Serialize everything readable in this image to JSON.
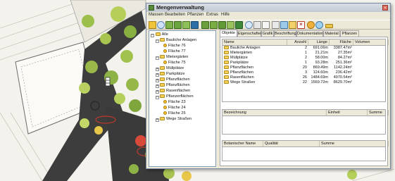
{
  "window": {
    "title": "Mengenverwaltung"
  },
  "menu": [
    "Massen",
    "Bearbeiten",
    "Pflanzen",
    "Extras",
    "Hilfe"
  ],
  "tree": {
    "root": "Alle",
    "items": [
      {
        "label": "Bauliche Anlagen",
        "type": "folder",
        "level": 1,
        "expanded": true
      },
      {
        "label": "Fläche 76",
        "type": "leaf",
        "level": 2
      },
      {
        "label": "Fläche 77",
        "type": "leaf",
        "level": 2
      },
      {
        "label": "Mietergärten",
        "type": "folder",
        "level": 1,
        "expanded": true
      },
      {
        "label": "Fläche 75",
        "type": "leaf",
        "level": 2
      },
      {
        "label": "Müllplätze",
        "type": "folder",
        "level": 1,
        "expanded": false
      },
      {
        "label": "Parkplätze",
        "type": "folder",
        "level": 1,
        "expanded": false
      },
      {
        "label": "Pflanzflächen",
        "type": "folder",
        "level": 1,
        "expanded": false
      },
      {
        "label": "Pflanzflächen",
        "type": "folder",
        "level": 1,
        "expanded": false
      },
      {
        "label": "Rasenflächen",
        "type": "folder",
        "level": 1,
        "expanded": false
      },
      {
        "label": "Pflanzerflächen",
        "type": "folder",
        "level": 1,
        "expanded": true
      },
      {
        "label": "Fläche 23",
        "type": "leaf",
        "level": 2
      },
      {
        "label": "Fläche 24",
        "type": "leaf",
        "level": 2
      },
      {
        "label": "Fläche 25",
        "type": "leaf",
        "level": 2
      },
      {
        "label": "Wege Straßen",
        "type": "folder",
        "level": 1,
        "expanded": false
      }
    ]
  },
  "tabs": [
    "Objekte",
    "Eigenschaften",
    "Grafik",
    "Beschriftung",
    "Dokumentation",
    "Material",
    "Pflanzen"
  ],
  "active_tab": "Objekte",
  "objects_table": {
    "headers": [
      "Name",
      "Anzahl",
      "Länge",
      "Fläche",
      "Volumen"
    ],
    "rows": [
      [
        "Bauliche Anlagen",
        "2",
        "691.06m",
        "3387.47m²",
        ""
      ],
      [
        "Mietergärten",
        "1",
        "21.21m",
        "27.35m²",
        ""
      ],
      [
        "Müllplätze",
        "2",
        "58.00m",
        "84.27m²",
        ""
      ],
      [
        "Parkplätze",
        "1",
        "93.28m",
        "251.36m²",
        ""
      ],
      [
        "Pflanzflächen",
        "20",
        "869.49m",
        "1142.24m²",
        ""
      ],
      [
        "Pflanzflächen",
        "3",
        "124.60m",
        "236.42m²",
        ""
      ],
      [
        "Rasenflächen",
        "26",
        "1484.69m",
        "4970.54m²",
        ""
      ],
      [
        "Wege Straßen",
        "22",
        "1569.72m",
        "8629.70m²",
        ""
      ]
    ]
  },
  "detail_table": {
    "headers": [
      "Bezeichnung",
      "Einheit",
      "Summe"
    ]
  },
  "plant_table": {
    "headers": [
      "Botanischer Name",
      "Qualität",
      "Summe"
    ]
  },
  "colors": {
    "accent": "#316ac5",
    "folder": "#f3cf55",
    "title_bar": "#c3c9d3"
  }
}
